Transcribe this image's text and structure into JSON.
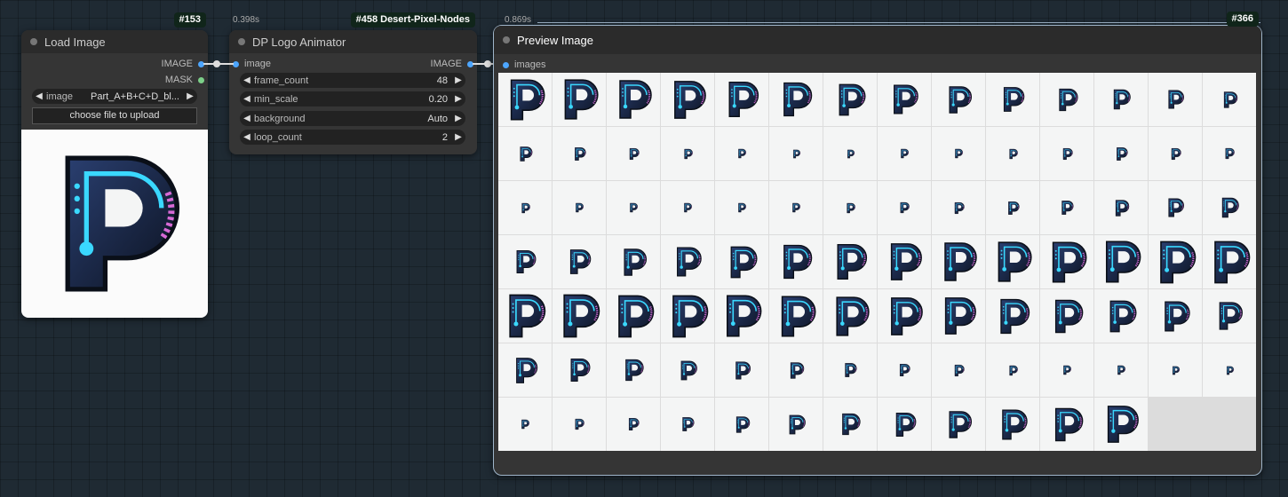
{
  "nodes": {
    "load_image": {
      "id": "#153",
      "title": "Load Image",
      "outputs": [
        "IMAGE",
        "MASK"
      ],
      "widget_image": {
        "name": "image",
        "value": "Part_A+B+C+D_bl..."
      },
      "upload_label": "choose file to upload"
    },
    "animator": {
      "id": "#458 Desert-Pixel-Nodes",
      "time": "0.398s",
      "title": "DP Logo Animator",
      "input": "image",
      "output": "IMAGE",
      "widgets": [
        {
          "name": "frame_count",
          "value": "48"
        },
        {
          "name": "min_scale",
          "value": "0.20"
        },
        {
          "name": "background",
          "value": "Auto"
        },
        {
          "name": "loop_count",
          "value": "2"
        }
      ]
    },
    "preview": {
      "id": "#366",
      "time": "0.869s",
      "title": "Preview Image",
      "input": "images",
      "frame_count": 96,
      "frame_scales": [
        0.95,
        0.93,
        0.9,
        0.87,
        0.83,
        0.78,
        0.73,
        0.68,
        0.63,
        0.57,
        0.52,
        0.47,
        0.42,
        0.38,
        0.34,
        0.3,
        0.27,
        0.24,
        0.22,
        0.2,
        0.2,
        0.21,
        0.22,
        0.24,
        0.27,
        0.3,
        0.27,
        0.25,
        0.23,
        0.22,
        0.22,
        0.22,
        0.22,
        0.22,
        0.23,
        0.25,
        0.27,
        0.3,
        0.33,
        0.37,
        0.42,
        0.47,
        0.53,
        0.58,
        0.63,
        0.68,
        0.73,
        0.78,
        0.83,
        0.86,
        0.89,
        0.92,
        0.94,
        0.96,
        0.98,
        0.99,
        1.0,
        1.0,
        0.99,
        0.98,
        0.96,
        0.94,
        0.91,
        0.88,
        0.85,
        0.81,
        0.77,
        0.73,
        0.69,
        0.64,
        0.59,
        0.54,
        0.5,
        0.45,
        0.41,
        0.37,
        0.33,
        0.29,
        0.26,
        0.24,
        0.22,
        0.21,
        0.2,
        0.2,
        0.22,
        0.25,
        0.29,
        0.33,
        0.38,
        0.44,
        0.5,
        0.56,
        0.63,
        0.7,
        0.77,
        0.85
      ]
    }
  },
  "colors": {
    "wire": "#dddddd",
    "slot_image": "#4da6ff",
    "slot_mask": "#7ccf88",
    "preview_border": "#9fb5c9",
    "logo_dark": "#101828",
    "logo_cyan": "#3ad8ff",
    "logo_pink": "#d86ad6"
  }
}
